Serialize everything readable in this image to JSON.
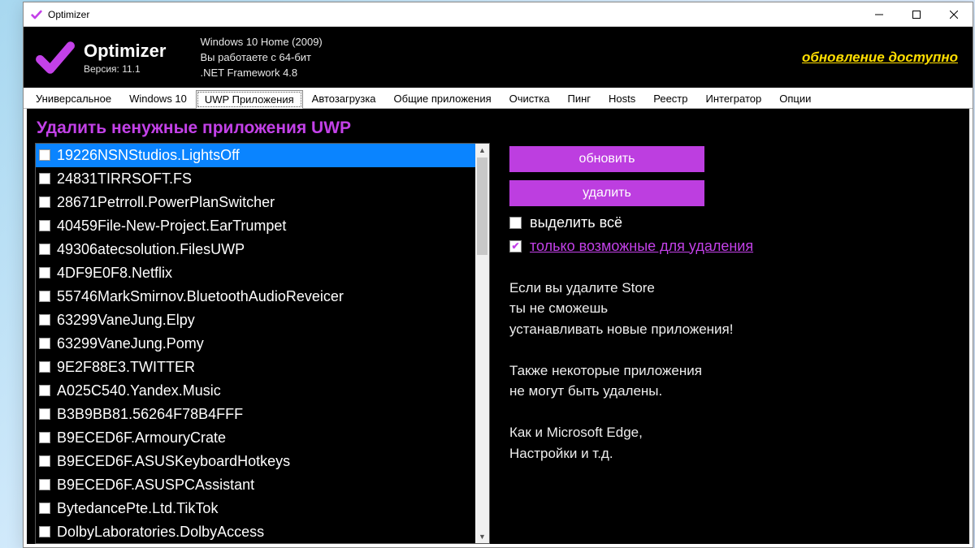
{
  "titlebar": {
    "title": "Optimizer"
  },
  "header": {
    "appname": "Optimizer",
    "version": "Версия: 11.1",
    "os": "Windows 10 Home (2009)",
    "arch": "Вы работаете с 64-бит",
    "net": ".NET Framework 4.8",
    "update": "обновление доступно"
  },
  "tabs": [
    "Универсальное",
    "Windows 10",
    "UWP Приложения",
    "Автозагрузка",
    "Общие приложения",
    "Очистка",
    "Пинг",
    "Hosts",
    "Реестр",
    "Интегратор",
    "Опции"
  ],
  "active_tab": 2,
  "section_title": "Удалить ненужные приложения UWP",
  "apps": [
    "19226NSNStudios.LightsOff",
    "24831TIRRSOFT.FS",
    "28671Petrroll.PowerPlanSwitcher",
    "40459File-New-Project.EarTrumpet",
    "49306atecsolution.FilesUWP",
    "4DF9E0F8.Netflix",
    "55746MarkSmirnov.BluetoothAudioReveicer",
    "63299VaneJung.Elpy",
    "63299VaneJung.Pomy",
    "9E2F88E3.TWITTER",
    "A025C540.Yandex.Music",
    "B3B9BB81.56264F78B4FFF",
    "B9ECED6F.ArmouryCrate",
    "B9ECED6F.ASUSKeyboardHotkeys",
    "B9ECED6F.ASUSPCAssistant",
    "BytedancePte.Ltd.TikTok",
    "DolbyLaboratories.DolbyAccess"
  ],
  "selected_app_index": 0,
  "buttons": {
    "refresh": "обновить",
    "delete": "удалить"
  },
  "checks": {
    "select_all": "выделить всё",
    "only_removable": "только возможные для удаления"
  },
  "warning": {
    "l1": "Если вы удалите Store",
    "l2": "ты не сможешь",
    "l3": "устанавливать новые приложения!",
    "l4": "Также некоторые приложения",
    "l5": "не могут быть удалены.",
    "l6": "Как и Microsoft Edge,",
    "l7": "Настройки и т.д."
  }
}
